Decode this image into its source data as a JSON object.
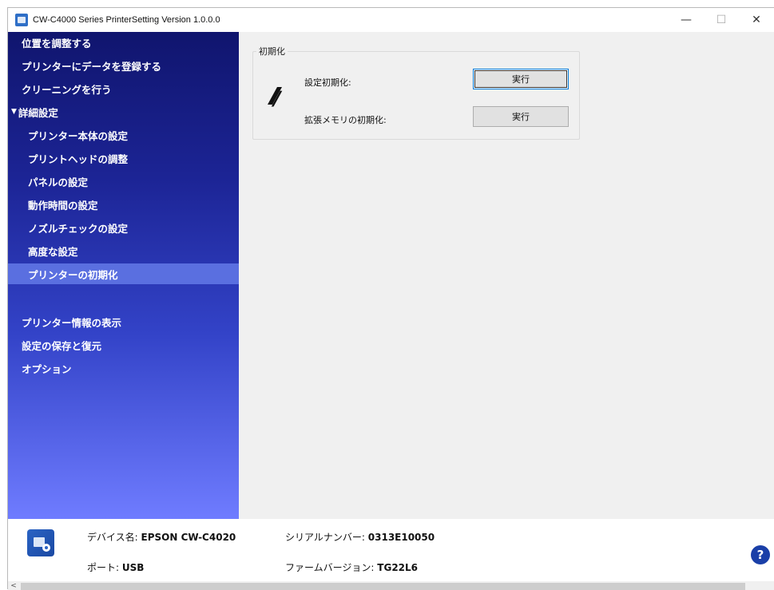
{
  "window": {
    "title": "CW-C4000 Series PrinterSetting Version 1.0.0.0",
    "controls": {
      "minimize": "—",
      "maximize": "☐",
      "close": "✕"
    }
  },
  "sidebar": {
    "items": [
      {
        "label": "位置を調整する"
      },
      {
        "label": "プリンターにデータを登録する"
      },
      {
        "label": "クリーニングを行う"
      },
      {
        "label": "詳細設定",
        "marker": "▼"
      },
      {
        "label": "プリンター本体の設定"
      },
      {
        "label": "プリントヘッドの調整"
      },
      {
        "label": "パネルの設定"
      },
      {
        "label": "動作時間の設定"
      },
      {
        "label": "ノズルチェックの設定"
      },
      {
        "label": "高度な設定"
      },
      {
        "label": "プリンターの初期化",
        "selected": true
      },
      {
        "label": "プリンター情報の表示"
      },
      {
        "label": "設定の保存と復元"
      },
      {
        "label": "オプション"
      }
    ]
  },
  "main": {
    "group_title": "初期化",
    "rows": [
      {
        "label": "設定初期化:",
        "button": "実行"
      },
      {
        "label": "拡張メモリの初期化:",
        "button": "実行"
      }
    ]
  },
  "footer": {
    "device_name_label": "デバイス名:",
    "device_name_value": "EPSON CW-C4020",
    "serial_label": "シリアルナンバー:",
    "serial_value": "0313E10050",
    "port_label": "ポート:",
    "port_value": "USB",
    "firmware_label": "ファームバージョン:",
    "firmware_value": "TG22L6",
    "help": "?"
  },
  "scrollbar": {
    "left_arrow": "<"
  },
  "colors": {
    "sidebar_top": "#10156e",
    "sidebar_bottom": "#6f7cff",
    "selected_item": "#5a6fe0",
    "help_button": "#1a3fa8"
  }
}
